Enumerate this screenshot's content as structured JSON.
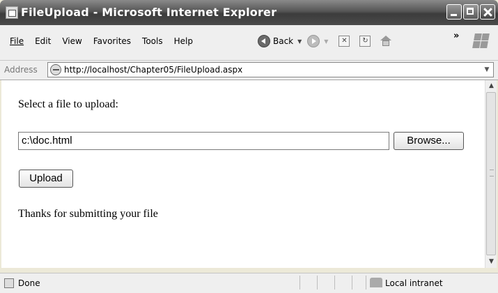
{
  "window": {
    "title": "FileUpload - Microsoft Internet Explorer"
  },
  "menu": {
    "items": [
      {
        "label": "File"
      },
      {
        "label": "Edit"
      },
      {
        "label": "View"
      },
      {
        "label": "Favorites"
      },
      {
        "label": "Tools"
      },
      {
        "label": "Help"
      }
    ]
  },
  "toolbar": {
    "back_label": "Back",
    "overflow_glyph": "»"
  },
  "address": {
    "label": "Address",
    "url": "http://localhost/Chapter05/FileUpload.aspx"
  },
  "page": {
    "prompt": "Select a file to upload:",
    "file_value": "c:\\doc.html",
    "browse_label": "Browse...",
    "upload_label": "Upload",
    "message": "Thanks for submitting your file"
  },
  "status": {
    "text": "Done",
    "zone": "Local intranet"
  },
  "icons": [
    "ie-app-icon",
    "minimize-icon",
    "maximize-icon",
    "close-icon",
    "back-icon",
    "forward-icon",
    "stop-icon",
    "refresh-icon",
    "home-icon",
    "windows-flag-icon",
    "page-icon",
    "intranet-icon"
  ]
}
